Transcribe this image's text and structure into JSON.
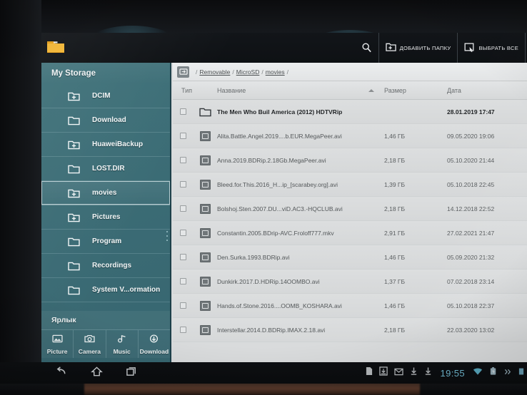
{
  "app": {
    "icon": "folder-icon",
    "title": "My Storage"
  },
  "toolbar": {
    "search_icon": "search-icon",
    "add_folder_icon": "add-folder-icon",
    "add_folder_label": "ДОБАВИТЬ ПАПКУ",
    "select_all_icon": "select-all-icon",
    "select_all_label": "ВЫБРАТЬ ВСЕ"
  },
  "sidebar": {
    "header": "My Storage",
    "items": [
      {
        "label": "DCIM",
        "icon": "folder-add-icon",
        "selected": false
      },
      {
        "label": "Download",
        "icon": "folder-icon",
        "selected": false
      },
      {
        "label": "HuaweiBackup",
        "icon": "folder-add-icon",
        "selected": false
      },
      {
        "label": "LOST.DIR",
        "icon": "folder-icon",
        "selected": false
      },
      {
        "label": "movies",
        "icon": "folder-add-icon",
        "selected": true
      },
      {
        "label": "Pictures",
        "icon": "folder-add-icon",
        "selected": false
      },
      {
        "label": "Program",
        "icon": "folder-icon",
        "selected": false
      },
      {
        "label": "Recordings",
        "icon": "folder-icon",
        "selected": false
      },
      {
        "label": "System V...ormation",
        "icon": "folder-icon",
        "selected": false
      }
    ],
    "shortcuts_title": "Ярлык",
    "shortcuts": [
      {
        "label": "Picture",
        "icon": "picture-icon"
      },
      {
        "label": "Camera",
        "icon": "camera-icon"
      },
      {
        "label": "Music",
        "icon": "music-icon"
      },
      {
        "label": "Download",
        "icon": "download-icon"
      }
    ]
  },
  "breadcrumb": {
    "home_icon": "breadcrumb-home-icon",
    "leading_separator": "/",
    "segments": [
      "Removable",
      "MicroSD",
      "movies"
    ],
    "trailing_separator": "/",
    "separator": "/"
  },
  "table": {
    "columns": {
      "type": "Тип",
      "name": "Название",
      "size": "Размер",
      "date": "Дата"
    },
    "sort_column": "name",
    "sort_direction": "asc",
    "rows": [
      {
        "icon": "folder-icon",
        "is_folder": true,
        "name": "The Men Who Buil America (2012) HDTVRip",
        "size": "",
        "date": "28.01.2019 17:47"
      },
      {
        "icon": "video-icon",
        "is_folder": false,
        "name": "Alita.Battle.Angel.2019....b.EUR.MegaPeer.avi",
        "size": "1,46 ГБ",
        "date": "09.05.2020 19:06"
      },
      {
        "icon": "video-icon",
        "is_folder": false,
        "name": "Anna.2019.BDRip.2.18Gb.MegaPeer.avi",
        "size": "2,18 ГБ",
        "date": "05.10.2020 21:44"
      },
      {
        "icon": "video-icon",
        "is_folder": false,
        "name": "Bleed.for.This.2016_H...ip_[scarabey.org].avi",
        "size": "1,39 ГБ",
        "date": "05.10.2018 22:45"
      },
      {
        "icon": "video-icon",
        "is_folder": false,
        "name": "Bolshoj.Sten.2007.DU...viD.AC3.-HQCLUB.avi",
        "size": "2,18 ГБ",
        "date": "14.12.2018 22:52"
      },
      {
        "icon": "video-icon",
        "is_folder": false,
        "name": "Constantin.2005.BDrip-AVC.Froloff777.mkv",
        "size": "2,91 ГБ",
        "date": "27.02.2021 21:47"
      },
      {
        "icon": "video-icon",
        "is_folder": false,
        "name": "Den.Surka.1993.BDRip.avi",
        "size": "1,46 ГБ",
        "date": "05.09.2020 21:32"
      },
      {
        "icon": "video-icon",
        "is_folder": false,
        "name": "Dunkirk.2017.D.HDRip.14OOMBO.avi",
        "size": "1,37 ГБ",
        "date": "07.02.2018 23:14"
      },
      {
        "icon": "video-icon",
        "is_folder": false,
        "name": "Hands.of.Stone.2016....OOMB_KOSHARA.avi",
        "size": "1,46 ГБ",
        "date": "05.10.2018 22:37"
      },
      {
        "icon": "video-icon",
        "is_folder": false,
        "name": "Interstellar.2014.D.BDRip.IMAX.2.18.avi",
        "size": "2,18 ГБ",
        "date": "22.03.2020 13:02"
      }
    ]
  },
  "navbar": {
    "back_icon": "back-icon",
    "home_icon": "home-icon",
    "recents_icon": "recents-icon",
    "status_icons": [
      "sd-card-icon",
      "save-icon",
      "mail-icon",
      "download-icon",
      "download-icon"
    ],
    "clock": "19:55",
    "right_icons": [
      "wifi-icon",
      "battery-icon",
      "more-icon"
    ]
  },
  "colors": {
    "sidebar_teal": "#3f7179",
    "content_gray": "#d9dbdc",
    "appbar_dark": "#121519",
    "clock_blue": "#6fb8cf",
    "folder_orange": "#f0a81e"
  }
}
